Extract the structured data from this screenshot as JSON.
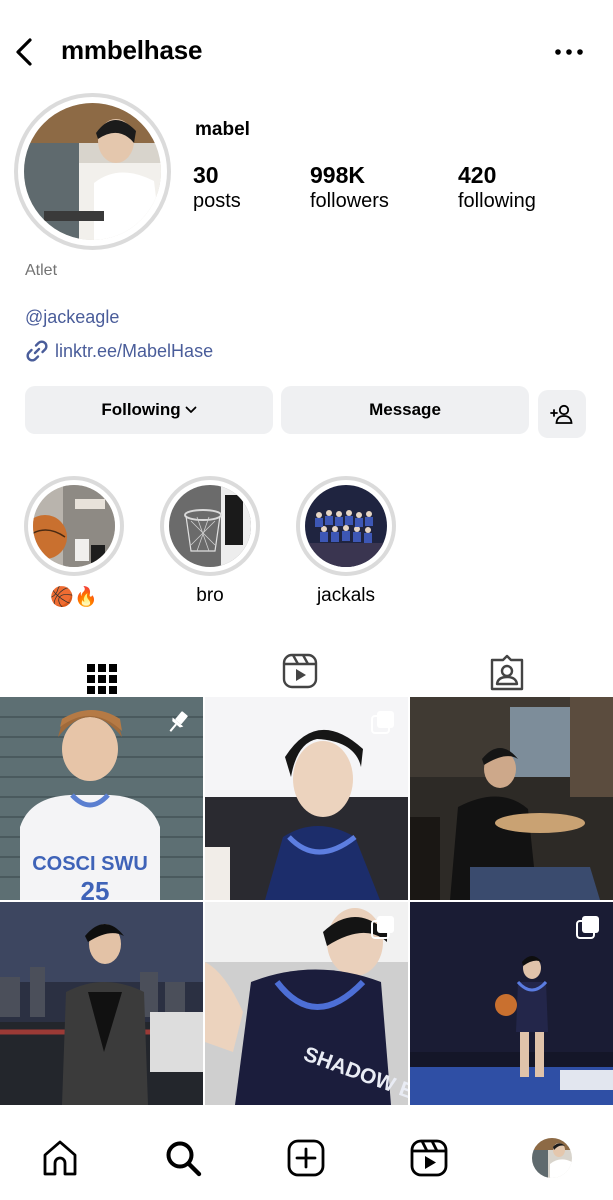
{
  "header": {
    "username": "mmbelhase"
  },
  "profile": {
    "display_name": "mabel",
    "stats": {
      "posts_count": "30",
      "posts_label": "posts",
      "followers_count": "998K",
      "followers_label": "followers",
      "following_count": "420",
      "following_label": "following"
    },
    "category": "Atlet",
    "mention": "@jackeagle",
    "link": "linktr.ee/MabelHase"
  },
  "actions": {
    "following_label": "Following",
    "message_label": "Message"
  },
  "highlights": [
    {
      "label": "🏀🔥"
    },
    {
      "label": "bro"
    },
    {
      "label": "jackals"
    }
  ],
  "tabs": [
    {
      "icon": "grid-icon",
      "active": true
    },
    {
      "icon": "reels-icon",
      "active": false
    },
    {
      "icon": "tagged-icon",
      "active": false
    }
  ],
  "posts": [
    {
      "badge": "pin-icon",
      "jersey_text": "COSCI SWU",
      "jersey_number": "25"
    },
    {
      "badge": "carousel-icon"
    },
    {
      "badge": "none"
    },
    {
      "badge": "none"
    },
    {
      "badge": "carousel-icon",
      "jersey_text": "SHADOW EAGLE"
    },
    {
      "badge": "carousel-icon"
    }
  ],
  "bottom_nav": [
    {
      "icon": "home-icon"
    },
    {
      "icon": "search-icon"
    },
    {
      "icon": "create-icon"
    },
    {
      "icon": "reels-icon"
    },
    {
      "icon": "profile-avatar"
    }
  ],
  "colors": {
    "link": "#4a5d9a",
    "button_bg": "#eff0f2",
    "ring": "#dbdbdb",
    "muted": "#737373"
  }
}
